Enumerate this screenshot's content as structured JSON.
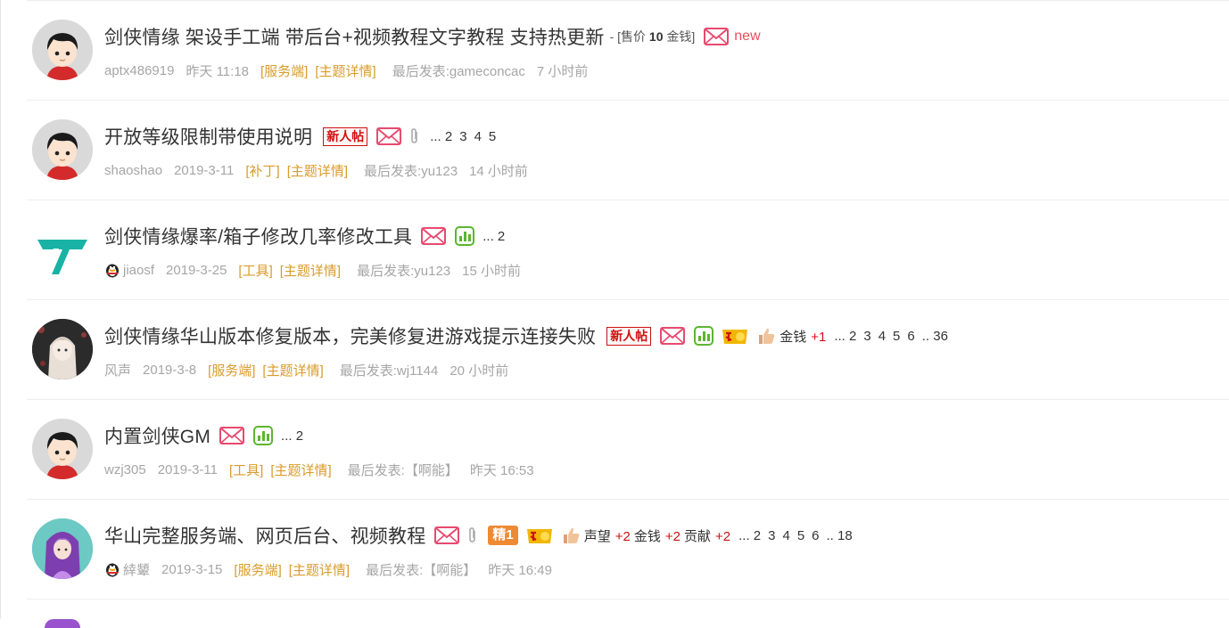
{
  "threads": [
    {
      "title": "剑侠情缘 架设手工端 带后台+视频教程文字教程 支持热更新",
      "price": {
        "prefix": "- [售价 ",
        "amount": "10",
        "suffix": " 金钱]"
      },
      "new_label": "new",
      "author": "aptx486919",
      "date": "昨天 11:18",
      "category": "[服务端]",
      "detail": "[主题详情]",
      "last_post": "最后发表:gameconcac",
      "last_time": "7 小时前"
    },
    {
      "title": "开放等级限制带使用说明",
      "new_badge": "新人帖",
      "pages": [
        "... 2",
        "3",
        "4",
        "5"
      ],
      "author": "shaoshao",
      "date": "2019-3-11",
      "category": "[补丁]",
      "detail": "[主题详情]",
      "last_post": "最后发表:yu123",
      "last_time": "14 小时前"
    },
    {
      "title": "剑侠情缘爆率/箱子修改几率修改工具",
      "pages": [
        "... 2"
      ],
      "author": "jiaosf",
      "date": "2019-3-25",
      "category": "[工具]",
      "detail": "[主题详情]",
      "last_post": "最后发表:yu123",
      "last_time": "15 小时前"
    },
    {
      "title": "剑侠情缘华山版本修复版本，完美修复进游戏提示连接失败",
      "new_badge": "新人帖",
      "credits": [
        {
          "label": "金钱",
          "value": "+1"
        }
      ],
      "pages": [
        "... 2",
        "3",
        "4",
        "5",
        "6",
        ".. 36"
      ],
      "author": "风声",
      "date": "2019-3-8",
      "category": "[服务端]",
      "detail": "[主题详情]",
      "last_post": "最后发表:wj1144",
      "last_time": "20 小时前"
    },
    {
      "title": "内置剑侠GM",
      "pages": [
        "... 2"
      ],
      "author": "wzj305",
      "date": "2019-3-11",
      "category": "[工具]",
      "detail": "[主题详情]",
      "last_post": "最后发表:【啊能】",
      "last_time": "昨天 16:53"
    },
    {
      "title": "华山完整服务端、网页后台、视频教程",
      "jing_badge": "精1",
      "credits": [
        {
          "label": "声望",
          "value": "+2"
        },
        {
          "label": "金钱",
          "value": "+2"
        },
        {
          "label": "贡献",
          "value": "+2"
        }
      ],
      "pages": [
        "... 2",
        "3",
        "4",
        "5",
        "6",
        ".. 18"
      ],
      "author": "緈顰",
      "date": "2019-3-15",
      "category": "[服务端]",
      "detail": "[主题详情]",
      "last_post": "最后发表:【啊能】",
      "last_time": "昨天 16:49"
    }
  ],
  "colors": {
    "category": "#d99b2b",
    "meta": "#a6a6a6",
    "new": "#e8505b",
    "badge_red": "#d01010",
    "mail": "#e84a6f",
    "poll": "#5cb531",
    "logo": "#19b3a6"
  },
  "icons": [
    "default-avatar-icon",
    "teal-logo-avatar-icon",
    "anime-avatar-icon",
    "mail-icon",
    "attachment-icon",
    "poll-icon",
    "hot-icon",
    "thumb-icon",
    "qq-penguin-icon"
  ]
}
